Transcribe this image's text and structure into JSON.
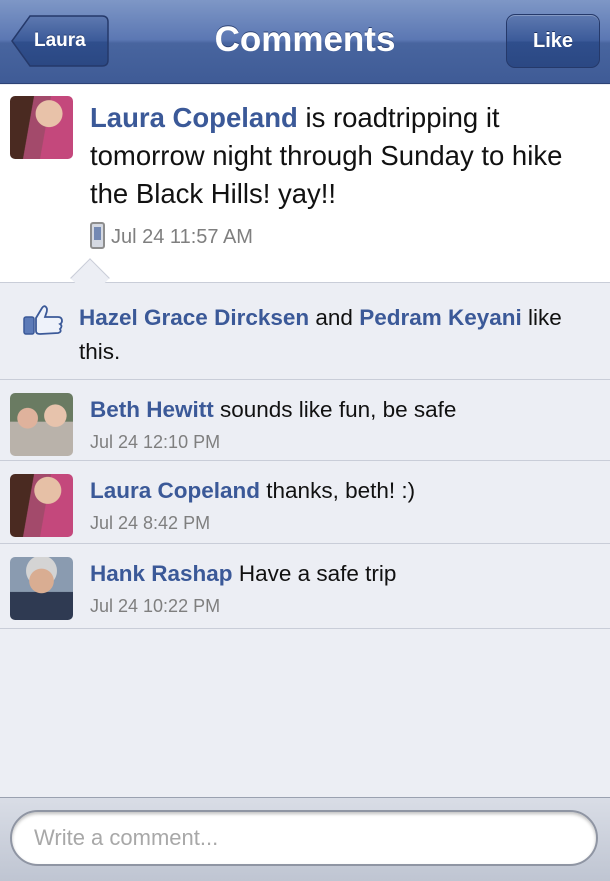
{
  "navbar": {
    "title": "Comments",
    "back_label": "Laura",
    "like_label": "Like"
  },
  "post": {
    "author": "Laura Copeland",
    "text": " is roadtripping it tomorrow night through Sunday to hike the Black Hills! yay!!",
    "timestamp": "Jul 24 11:57 AM",
    "timestamp_icon": "mobile-phone-icon"
  },
  "likes": {
    "icon": "thumbs-up-icon",
    "person1": "Hazel Grace Dircksen",
    "joiner": " and ",
    "person2": "Pedram Keyani",
    "suffix": " like this."
  },
  "comments": [
    {
      "author": "Beth Hewitt",
      "text": " sounds like fun, be safe",
      "timestamp": "Jul 24 12:10 PM"
    },
    {
      "author": "Laura Copeland",
      "text": " thanks, beth! :)",
      "timestamp": "Jul 24 8:42 PM"
    },
    {
      "author": "Hank Rashap",
      "text": " Have a safe trip",
      "timestamp": "Jul 24 10:22 PM"
    }
  ],
  "compose": {
    "placeholder": "Write a comment..."
  },
  "colors": {
    "navbar": "#4b679f",
    "link_name": "#3b5998",
    "background": "#eceef4"
  }
}
